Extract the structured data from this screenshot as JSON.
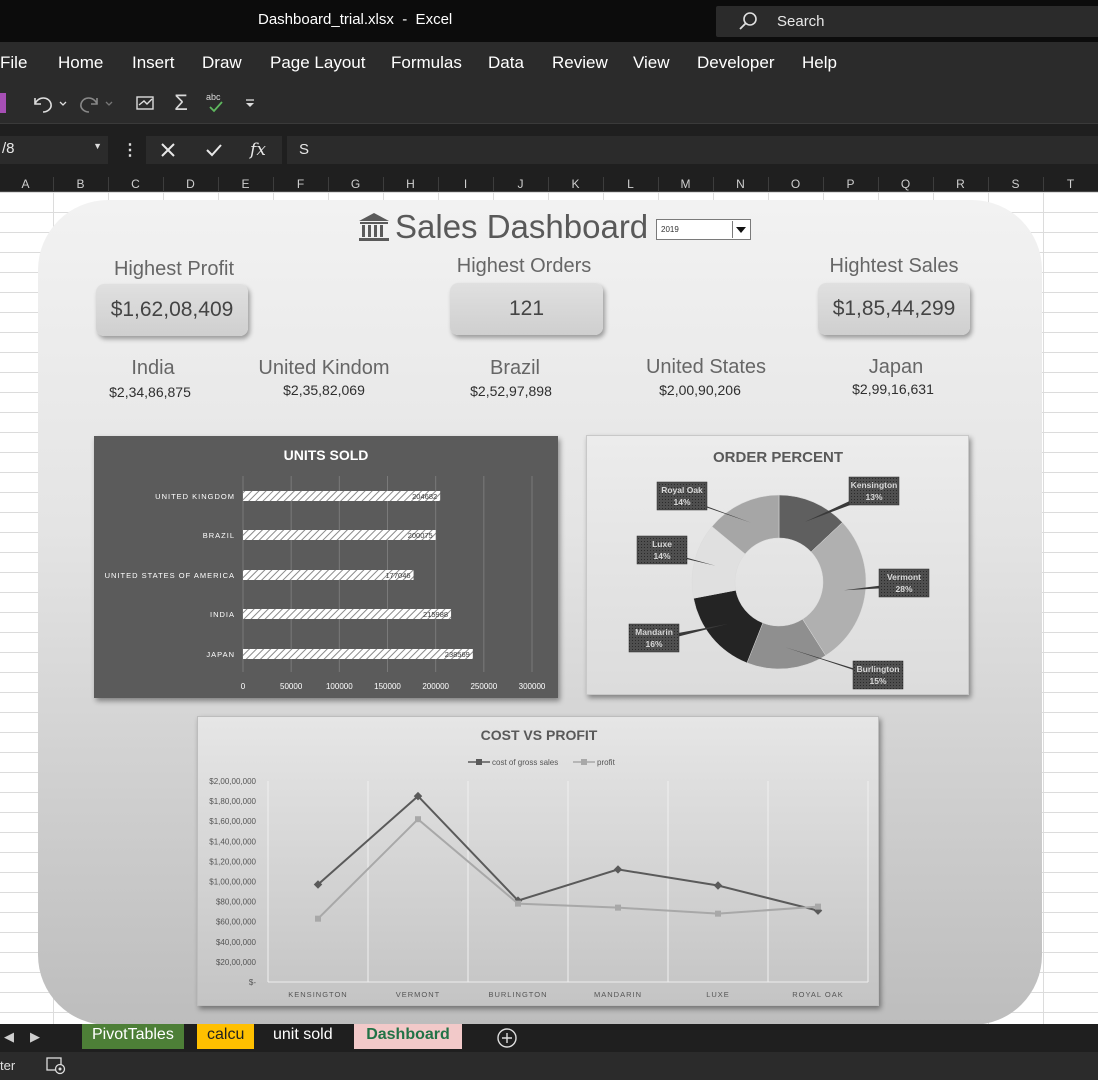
{
  "window": {
    "title": "Dashboard_trial.xlsx  -  Excel",
    "search_label": "Search"
  },
  "menu": [
    "File",
    "Home",
    "Insert",
    "Draw",
    "Page Layout",
    "Formulas",
    "Data",
    "Review",
    "View",
    "Developer",
    "Help"
  ],
  "formula_bar": {
    "name_box": "/8",
    "formula": "S"
  },
  "columns": [
    "A",
    "B",
    "C",
    "D",
    "E",
    "F",
    "G",
    "H",
    "I",
    "J",
    "K",
    "L",
    "M",
    "N",
    "O",
    "P",
    "Q",
    "R",
    "S",
    "T"
  ],
  "dashboard": {
    "title": "Sales Dashboard",
    "year_selected": "2019",
    "kpis": [
      {
        "label": "Highest Profit",
        "value": "$1,62,08,409"
      },
      {
        "label": "Highest Orders",
        "value": "121"
      },
      {
        "label": "Hightest Sales",
        "value": "$1,85,44,299"
      }
    ],
    "countries": [
      {
        "name": "India",
        "value": "$2,34,86,875"
      },
      {
        "name": "United Kindom",
        "value": "$2,35,82,069"
      },
      {
        "name": "Brazil",
        "value": "$2,52,97,898"
      },
      {
        "name": "United States",
        "value": "$2,00,90,206"
      },
      {
        "name": "Japan",
        "value": "$2,99,16,631"
      }
    ]
  },
  "chart_data": [
    {
      "type": "bar",
      "orientation": "horizontal",
      "title": "UNITS SOLD",
      "categories": [
        "UNITED KINGDOM",
        "BRAZIL",
        "UNITED STATES OF AMERICA",
        "INDIA",
        "JAPAN"
      ],
      "values": [
        204682,
        200075,
        177046,
        215988,
        238569
      ],
      "xlim": [
        0,
        300000
      ],
      "xticks": [
        "0",
        "50000",
        "100000",
        "150000",
        "200000",
        "250000",
        "300000"
      ],
      "grid": true,
      "colors": {
        "background": "#5b5b5b",
        "bar": "#ffffff",
        "text": "#ffffff"
      }
    },
    {
      "type": "pie",
      "style": "donut",
      "title": "ORDER PERCENT",
      "slices": [
        {
          "label": "Kensington",
          "value": 13,
          "text": "13%",
          "color": "#5f5f5f"
        },
        {
          "label": "Vermont",
          "value": 28,
          "text": "28%",
          "color": "#b0b0b0"
        },
        {
          "label": "Burlington",
          "value": 15,
          "text": "15%",
          "color": "#8f8f8f"
        },
        {
          "label": "Mandarin",
          "value": 16,
          "text": "16%",
          "color": "#242424"
        },
        {
          "label": "Luxe",
          "value": 14,
          "text": "14%",
          "color": "#e0e0e0"
        },
        {
          "label": "Royal Oak",
          "value": 14,
          "text": "14%",
          "color": "#a6a6a6"
        }
      ]
    },
    {
      "type": "line",
      "title": "COST VS PROFIT",
      "categories": [
        "KENSINGTON",
        "VERMONT",
        "BURLINGTON",
        "MANDARIN",
        "LUXE",
        "ROYAL OAK"
      ],
      "series": [
        {
          "name": "cost of gross sales",
          "values": [
            9700000,
            18500000,
            8100000,
            11200000,
            9600000,
            7100000
          ],
          "color": "#5a5a5a"
        },
        {
          "name": "profit",
          "values": [
            6300000,
            16200000,
            7800000,
            7400000,
            6800000,
            7500000
          ],
          "color": "#a8a8a8"
        }
      ],
      "ylim": [
        0,
        20000000
      ],
      "yticks": [
        "$-",
        "$20,00,000",
        "$40,00,000",
        "$60,00,000",
        "$80,00,000",
        "$1,00,00,000",
        "$1,20,00,000",
        "$1,40,00,000",
        "$1,60,00,000",
        "$1,80,00,000",
        "$2,00,00,000"
      ],
      "grid": true,
      "legend": "top"
    }
  ],
  "sheets": [
    {
      "name": "PivotTables",
      "bg": "#4d7f37",
      "fg": "#ffffff"
    },
    {
      "name": "calcu",
      "bg": "#ffc000",
      "fg": "#1f1f1f"
    },
    {
      "name": "unit sold",
      "bg": "#1f1f1f",
      "fg": "#ffffff"
    },
    {
      "name": "Dashboard",
      "bg": "#f2c9c9",
      "fg": "#217346"
    }
  ],
  "status": {
    "mode": "ter"
  }
}
